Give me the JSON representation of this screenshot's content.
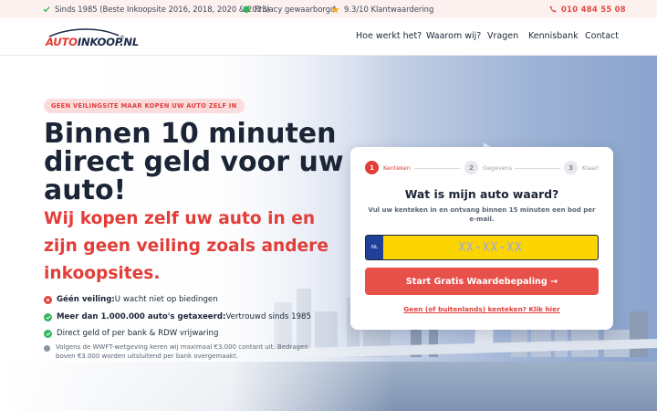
{
  "topbar": {
    "since": "Sinds 1985 (Beste Inkoopsite 2016, 2018, 2020 & 2023)",
    "privacy": "Privacy gewaarborgd",
    "rating": "9.3/10 Klantwaardering",
    "phone": "010 484 55 08"
  },
  "header": {
    "logo_part1": "AUTO",
    "logo_part2": "INKOOP.NL",
    "logo_reg": "®",
    "nav": [
      "Hoe werkt het?",
      "Waarom wij?",
      "Vragen",
      "Kennisbank",
      "Contact"
    ]
  },
  "hero": {
    "badge": "GEEN VEILINGSITE MAAR KOPEN UW AUTO ZELF IN",
    "title": "Binnen 10 minuten direct geld voor uw auto!",
    "subtitle": "Wij kopen zelf uw auto in en zijn geen veiling zoals andere inkoopsites.",
    "features": [
      {
        "bold": "Géén veiling:",
        "text": " U wacht niet op biedingen",
        "color": "#e23e39"
      },
      {
        "bold": "Meer dan 1.000.000 auto's getaxeerd:",
        "text": " Vertrouwd sinds 1985",
        "color": "#2fb55a"
      },
      {
        "bold": "",
        "text": "Direct geld of per bank & RDW vrijwaring",
        "color": "#2fb55a"
      }
    ],
    "note": "Volgens de WWFT-wetgeving keren wij maximaal €3.000 contant uit. Bedragen boven €3.000 worden uitsluitend per bank overgemaakt."
  },
  "card": {
    "steps": [
      {
        "num": "1",
        "label": "Kenteken"
      },
      {
        "num": "2",
        "label": "Gegevens"
      },
      {
        "num": "3",
        "label": "Klaar!"
      }
    ],
    "title": "Wat is mijn auto waard?",
    "subtitle": "Vul uw kenteken in en ontvang binnen 15 minuten een bod per e-mail.",
    "plate_country": "NL",
    "plate_placeholder": "XX-XX-XX",
    "plate_value": "",
    "cta": "Start Gratis Waardebepaling →",
    "link": "Geen (of buitenlands) kenteken? Klik hier"
  }
}
